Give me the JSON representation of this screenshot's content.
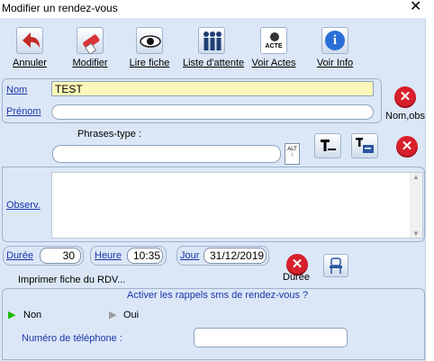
{
  "window": {
    "title": "Modifier un rendez-vous",
    "close_glyph": "✕"
  },
  "toolbar": {
    "buttons": [
      {
        "label": "Annuler",
        "icon": "undo-arrow-icon"
      },
      {
        "label": "Modifier",
        "icon": "eraser-icon"
      },
      {
        "label": "Lire fiche",
        "icon": "eye-icon"
      },
      {
        "label": "Liste d'attente",
        "icon": "people-icon"
      },
      {
        "label": "Voir Actes",
        "icon": "actes-icon",
        "icon_text": "ACTE"
      },
      {
        "label": "Voir Info",
        "icon": "info-icon",
        "icon_text": "i"
      }
    ]
  },
  "patient": {
    "nom_label": "Nom",
    "nom_value": "TEST",
    "prenom_label": "Prénom",
    "prenom_value": "",
    "clear_label": "Nom,obs"
  },
  "phrases": {
    "label": "Phrases-type :",
    "value": "",
    "alt_text": "ALT"
  },
  "observ": {
    "label": "Observ.",
    "value": ""
  },
  "rdv": {
    "duree_label": "Durée",
    "duree_value": "30",
    "heure_label": "Heure",
    "heure_value": "10:35",
    "jour_label": "Jour",
    "jour_value": "31/12/2019",
    "clear_duree_label": "Durée"
  },
  "print": {
    "label": "Imprimer fiche du RDV..."
  },
  "sms": {
    "question": "Activer les rappels sms de rendez-vous ?",
    "non_label": "Non",
    "oui_label": "Oui",
    "phone_label": "Numéro de téléphone :",
    "phone_value": ""
  },
  "colors": {
    "accent": "#1a35a8",
    "background": "#dbe7f7",
    "danger": "#d81f2c",
    "highlight": "#fbf7b8",
    "radio_on": "#1db800"
  }
}
